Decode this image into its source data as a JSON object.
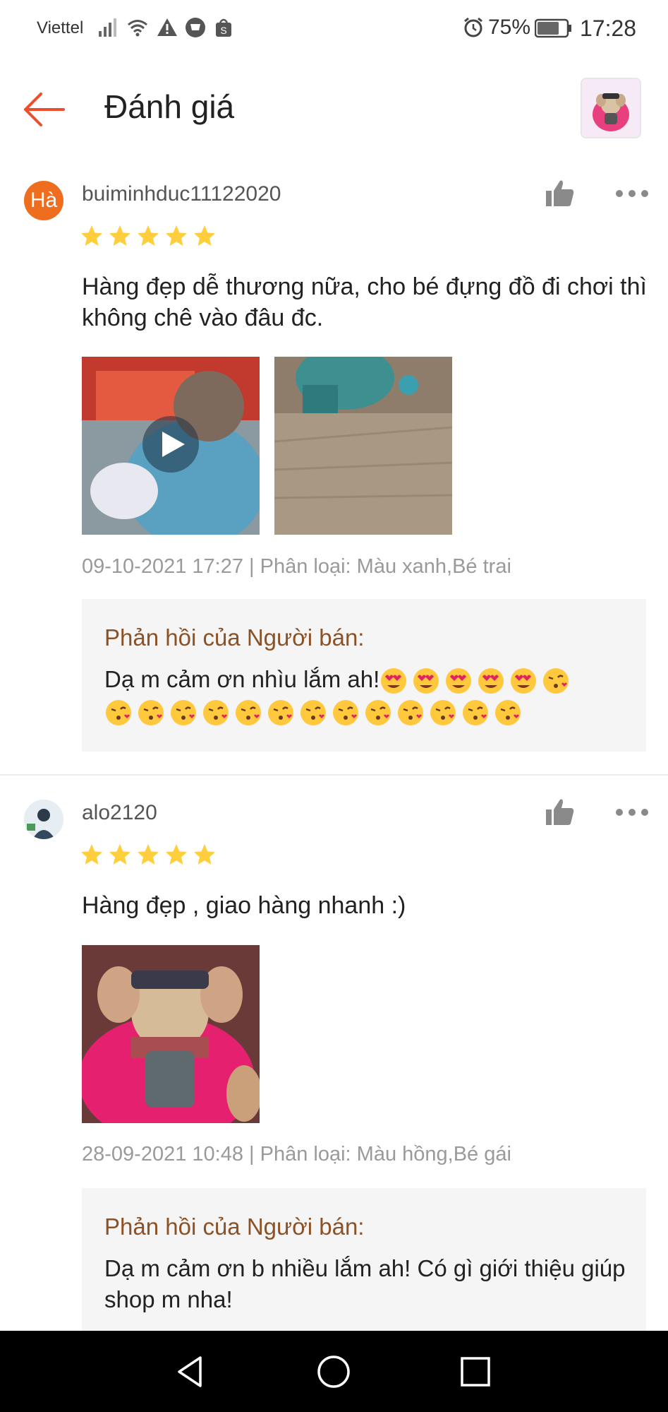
{
  "status_bar": {
    "carrier": "Viettel",
    "battery": "75%",
    "time": "17:28"
  },
  "header": {
    "title": "Đánh giá"
  },
  "reviews": [
    {
      "avatar_text": "Hà",
      "username": "buiminhduc11122020",
      "rating": 5,
      "text": "Hàng đẹp dễ thương nữa, cho bé đựng đồ đi chơi thì không chê vào đâu đc.",
      "meta": "09-10-2021 17:27 | Phân loại: Màu xanh,Bé trai",
      "reply_title": "Phản hồi của Người bán:",
      "reply_text": "Dạ m cảm ơn nhìu lắm ah!"
    },
    {
      "avatar_text": "",
      "username": "alo2120",
      "rating": 5,
      "text": "Hàng đẹp , giao hàng nhanh :)",
      "meta": "28-09-2021 10:48 | Phân loại: Màu hồng,Bé gái",
      "reply_title": "Phản hồi của Người bán:",
      "reply_text": "Dạ m cảm ơn b nhiều lắm ah! Có gì giới thiệu giúp shop m nha!"
    }
  ],
  "colors": {
    "accent": "#ee4d2d",
    "star": "#ffce3d",
    "reply_title": "#8a5226",
    "meta": "#9a9a9a"
  }
}
